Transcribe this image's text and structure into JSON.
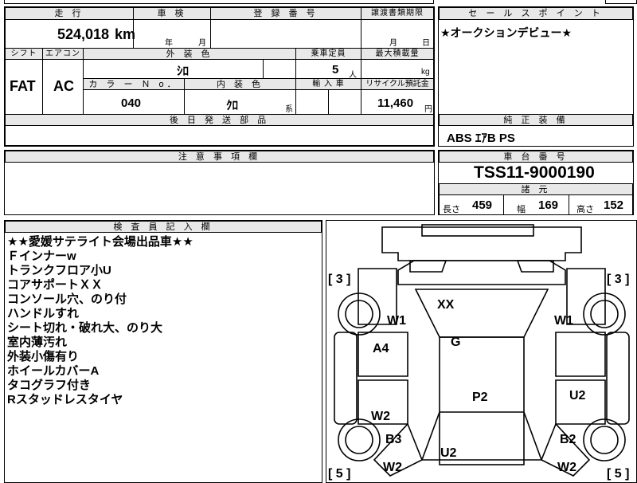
{
  "vehicle": {
    "headers": {
      "mileage": "走 行",
      "inspection": "車 検",
      "registration": "登 録 番 号",
      "transfer_deadline": "譲渡書類期限",
      "shift": "シフト",
      "aircon": "エアコン",
      "exterior_color": "外 装 色",
      "seating": "乗車定員",
      "max_load": "最大積載量",
      "color_no": "カ ラ ー Ｎ o．",
      "interior_color": "内 装 色",
      "import": "輸 入 車",
      "recycle_fee": "リサイクル預託金",
      "later_parts": "後 日 発 送 部 品"
    },
    "mileage_value": "524,018",
    "mileage_unit": "km",
    "inspection_year_unit": "年",
    "inspection_month_unit": "月",
    "transfer_month_unit": "月",
    "transfer_day_unit": "日",
    "shift_value": "FAT",
    "aircon_value": "AC",
    "exterior_color_value": "ｼﾛ",
    "seating_value": "5",
    "seating_unit": "人",
    "max_load_unit": "kg",
    "color_no_value": "040",
    "interior_color_value": "ｸﾛ",
    "interior_color_suffix": "系",
    "recycle_fee_value": "11,460",
    "recycle_fee_unit": "円"
  },
  "sales_point": {
    "header": "セ ー ル ス ポ イ ン ト",
    "text": "★オークションデビュー★"
  },
  "equipment": {
    "header": "純 正 装 備",
    "text": "ABS ｴｱB PS"
  },
  "caution": {
    "header": "注 意 事 項 欄"
  },
  "chassis": {
    "header": "車 台 番 号",
    "value": "TSS11-9000190"
  },
  "specs": {
    "header": "諸 元",
    "length_label": "長さ",
    "length_value": "459",
    "width_label": "幅",
    "width_value": "169",
    "height_label": "高さ",
    "height_value": "152"
  },
  "inspector": {
    "header": "検 査 員 記 入 欄",
    "lines": [
      "★★愛媛サテライト会場出品車★★",
      "Ｆインナーw",
      "トランクフロア小U",
      "コアサポートＸＸ",
      "コンソール穴、のり付",
      "ハンドルすれ",
      "シート切れ・破れ大、のり大",
      "室内薄汚れ",
      "外装小傷有り",
      "ホイールカバーA",
      "タコグラフ付き",
      "Rスタッドレスタイヤ"
    ]
  },
  "diagram": {
    "marks": {
      "tire_front_left": "[ 3 ]",
      "tire_front_right": "[ 3 ]",
      "tire_rear_left": "[ 5 ]",
      "tire_rear_right": "[ 5 ]",
      "xx": "XX",
      "w1_left": "W1",
      "w1_right": "W1",
      "a4": "A4",
      "g": "G",
      "p2": "P2",
      "u2_right": "U2",
      "w2_left": "W2",
      "b3": "B3",
      "b2": "B2",
      "u2_bottom": "U2",
      "w2_bottom_left": "W2",
      "w2_bottom_right": "W2"
    }
  }
}
